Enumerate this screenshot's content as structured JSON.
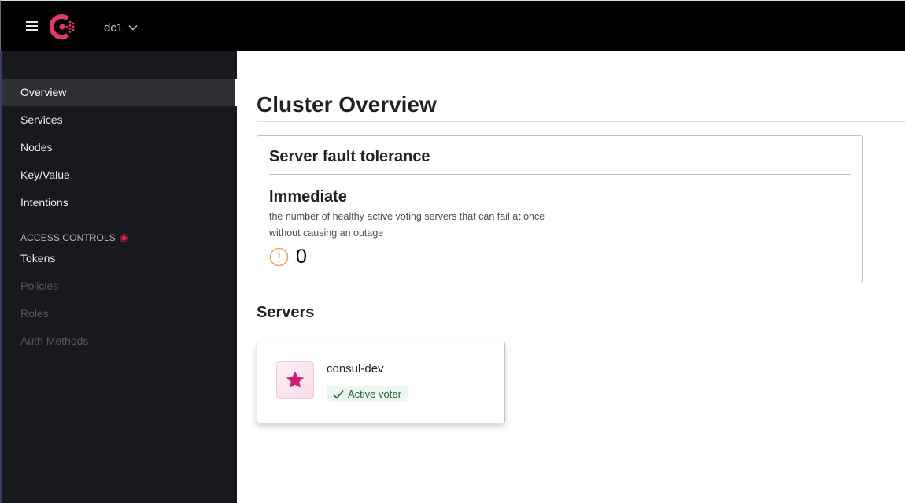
{
  "header": {
    "menu_icon": "hamburger-menu-icon",
    "logo": "consul-logo",
    "datacenter": "dc1",
    "datacenter_icon": "chevron-down-icon"
  },
  "sidebar": {
    "items": [
      {
        "label": "Overview",
        "state": "active"
      },
      {
        "label": "Services",
        "state": "normal"
      },
      {
        "label": "Nodes",
        "state": "normal"
      },
      {
        "label": "Key/Value",
        "state": "normal"
      },
      {
        "label": "Intentions",
        "state": "normal"
      }
    ],
    "access_controls": {
      "heading": "ACCESS CONTROLS",
      "indicator_color": "#e02454",
      "items": [
        {
          "label": "Tokens",
          "state": "normal"
        },
        {
          "label": "Policies",
          "state": "disabled"
        },
        {
          "label": "Roles",
          "state": "disabled"
        },
        {
          "label": "Auth Methods",
          "state": "disabled"
        }
      ]
    }
  },
  "main": {
    "title": "Cluster Overview",
    "fault_tolerance": {
      "title": "Server fault tolerance",
      "subtitle": "Immediate",
      "description": "the number of healthy active voting servers that can fail at once without causing an outage",
      "value": "0",
      "status_icon": "warning-circle-icon",
      "status_color": "#f2a35a"
    },
    "servers": {
      "title": "Servers",
      "items": [
        {
          "name": "consul-dev",
          "icon": "star-icon",
          "badge": "Active voter",
          "badge_icon": "check-icon"
        }
      ]
    }
  },
  "colors": {
    "brand": "#e03875",
    "star": "#ca2171",
    "badge_text": "#2c5c35",
    "badge_bg": "#ebf7ee"
  }
}
